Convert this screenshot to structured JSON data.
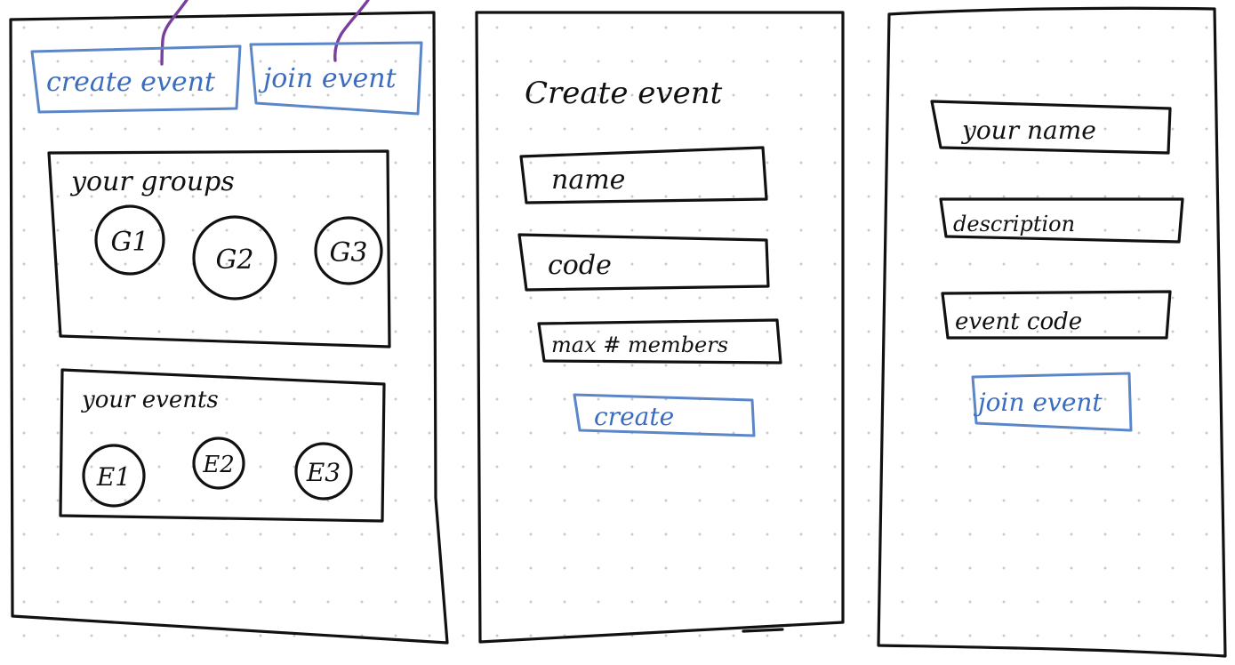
{
  "screen1": {
    "create_button": "create event",
    "join_button": "join event",
    "groups_title": "your groups",
    "groups": [
      "G1",
      "G2",
      "G3"
    ],
    "events_title": "your events",
    "events": [
      "E1",
      "E2",
      "E3"
    ]
  },
  "screen2": {
    "title": "Create event",
    "name_field": "name",
    "code_field": "code",
    "max_members_field": "max # members",
    "create_button": "create"
  },
  "screen3": {
    "your_name_field": "your name",
    "description_field": "description",
    "event_code_field": "event code",
    "join_button": "join event"
  },
  "colors": {
    "ink": "#111111",
    "blue_accent": "#5b86c8",
    "arrow_purple": "#7a3e9d"
  }
}
